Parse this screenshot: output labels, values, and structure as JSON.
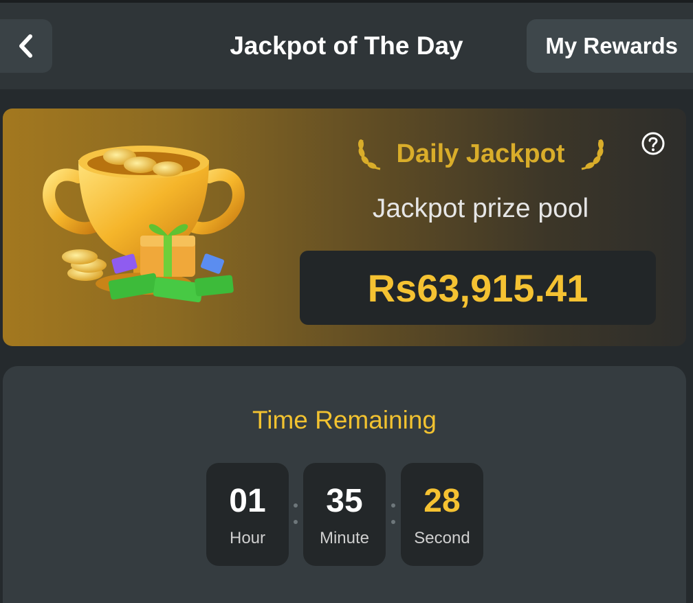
{
  "header": {
    "title": "Jackpot of The Day",
    "rewards_label": "My Rewards",
    "back_icon": "chevron-left-icon"
  },
  "jackpot": {
    "heading": "Daily Jackpot",
    "pool_label": "Jackpot prize pool",
    "amount": "Rs63,915.41",
    "help_icon": "question-circle-icon"
  },
  "timer": {
    "title": "Time Remaining",
    "units": [
      {
        "value": "01",
        "label": "Hour"
      },
      {
        "value": "35",
        "label": "Minute"
      },
      {
        "value": "28",
        "label": "Second"
      }
    ]
  },
  "colors": {
    "accent_gold": "#f5c232",
    "background": "#252a2d",
    "header_bg": "#2f3538",
    "card_bg": "#353c40"
  }
}
